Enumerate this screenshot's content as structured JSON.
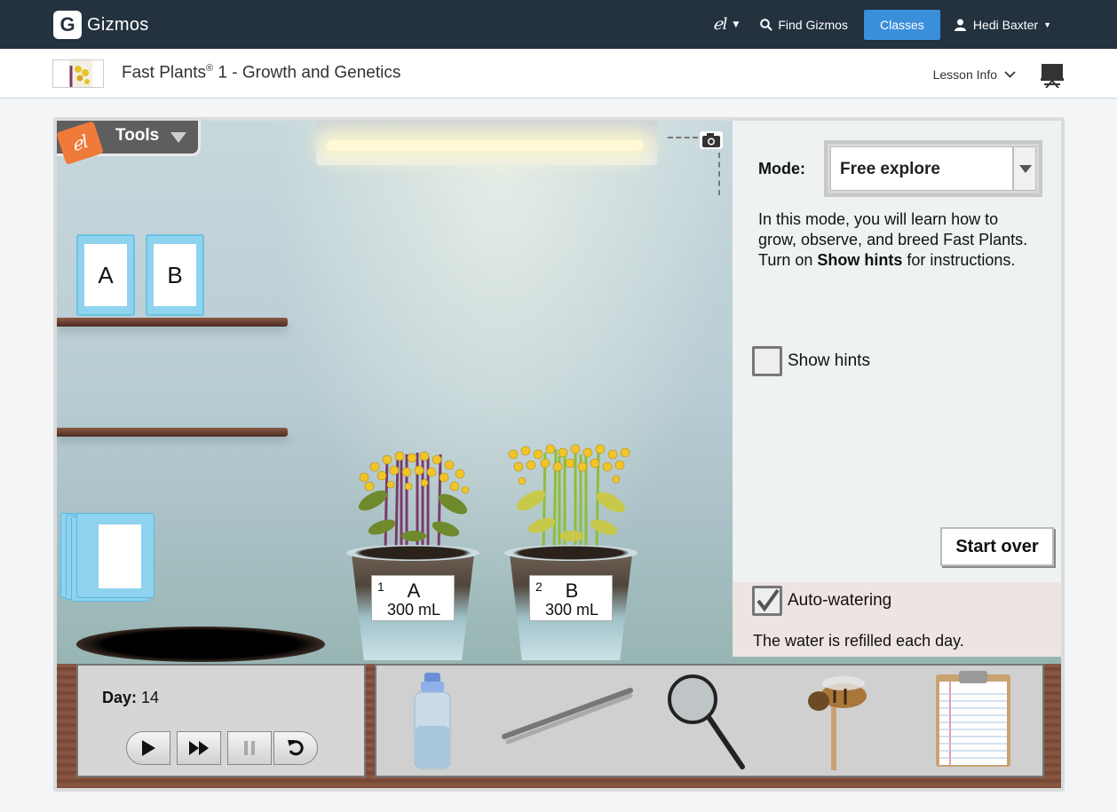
{
  "nav": {
    "brand": "Gizmos",
    "brand_letter": "G",
    "el_label": "ℯl",
    "find_label": "Find Gizmos",
    "classes_label": "Classes",
    "user_name": "Hedi Baxter"
  },
  "lesson": {
    "title": "Fast Plants",
    "reg": "®",
    "title_rest": " 1 - Growth and Genetics",
    "info_label": "Lesson Info"
  },
  "sim": {
    "tools_label": "Tools",
    "tools_el": "ℯl",
    "seed_packs": [
      "A",
      "B"
    ],
    "pots": [
      {
        "num": "1",
        "letter": "A",
        "volume": "300 mL"
      },
      {
        "num": "2",
        "letter": "B",
        "volume": "300 mL"
      }
    ],
    "panel": {
      "mode_label": "Mode:",
      "mode_value": "Free explore",
      "desc_1": "In this mode, you will learn how to grow, observe, and breed Fast Plants. Turn on ",
      "desc_bold": "Show hints",
      "desc_2": " for instructions.",
      "show_hints_label": "Show hints",
      "show_hints_checked": false,
      "start_over_label": "Start over",
      "auto_water_label": "Auto-watering",
      "auto_water_checked": true,
      "water_note": "The water is refilled each day."
    },
    "day_label": "Day:",
    "day_value": "14",
    "tool_items": [
      "water-bottle-icon",
      "tweezers-icon",
      "magnifier-icon",
      "bee-stick-icon",
      "clipboard-icon"
    ]
  },
  "colors": {
    "nav_bg": "#24313f",
    "accent": "#3a8fdb",
    "tools_orange": "#f07a3a",
    "seed_pack": "#8fd3ee"
  }
}
